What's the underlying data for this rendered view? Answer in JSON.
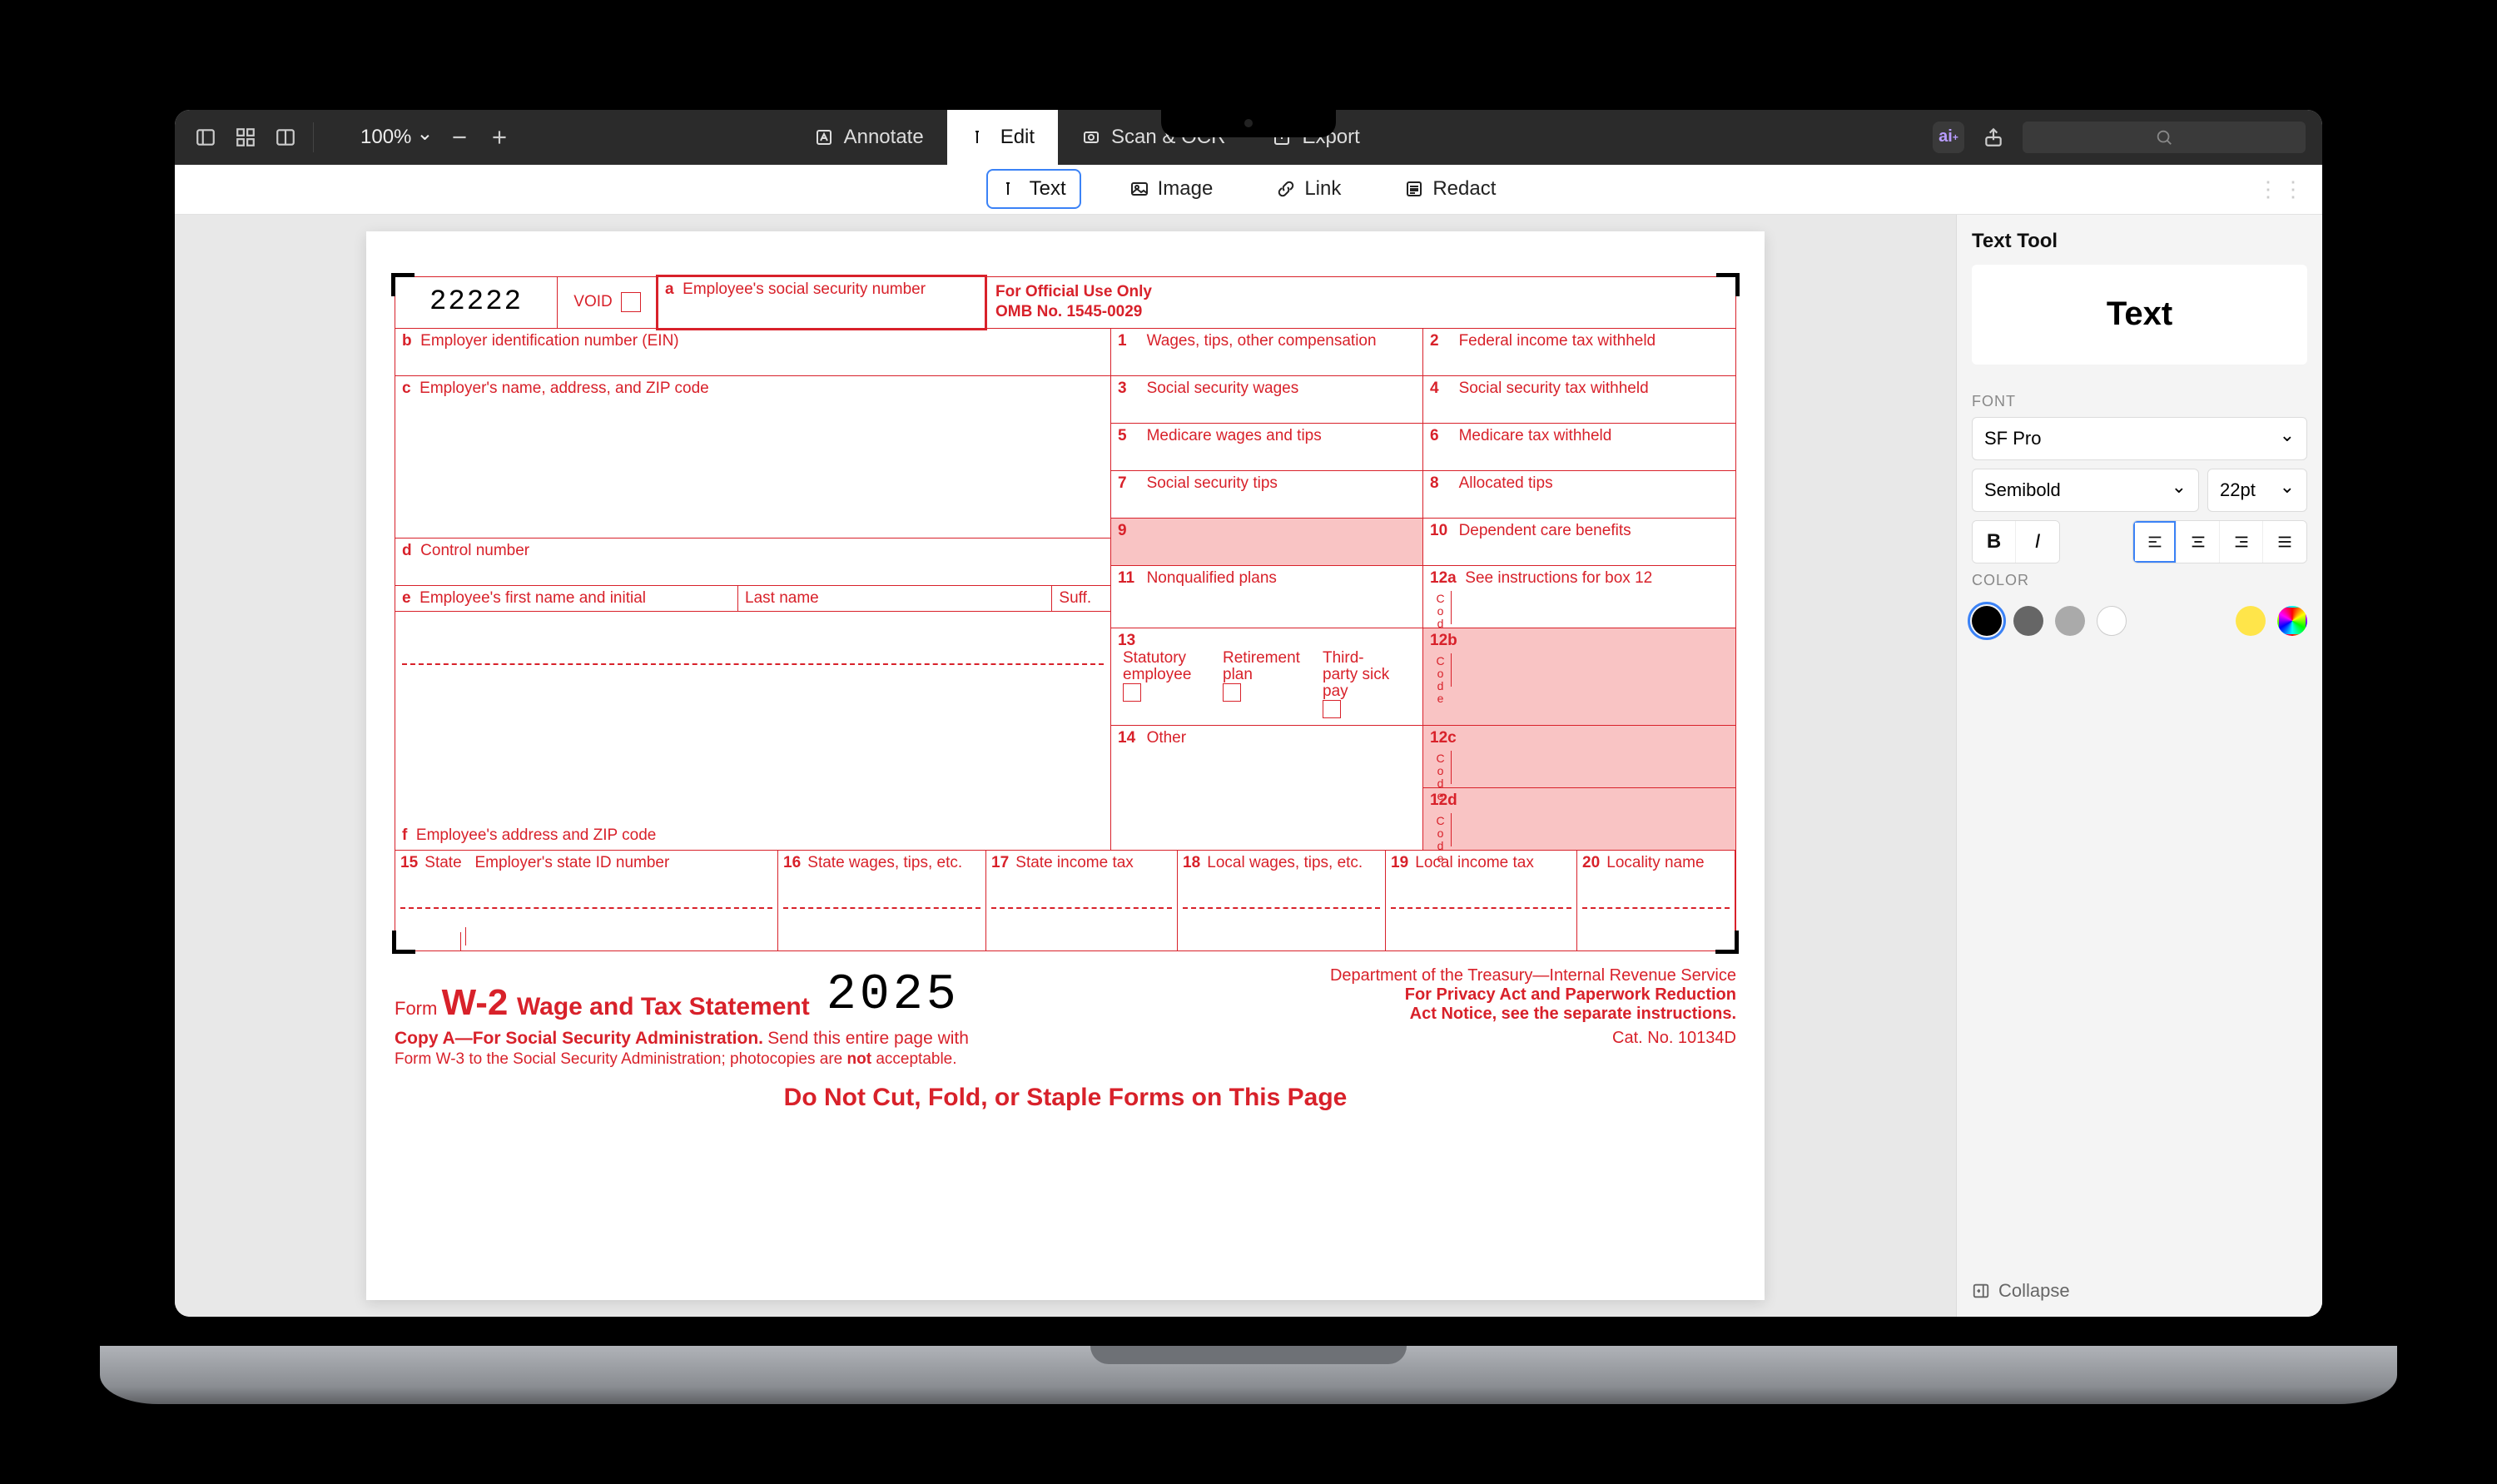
{
  "toolbar": {
    "zoom": "100%",
    "tabs": {
      "annotate": "Annotate",
      "edit": "Edit",
      "scan": "Scan & OCR",
      "export": "Export"
    }
  },
  "subbar": {
    "text": "Text",
    "image": "Image",
    "link": "Link",
    "redact": "Redact"
  },
  "panel": {
    "title": "Text Tool",
    "sample": "Text",
    "font_label": "FONT",
    "font_family": "SF Pro",
    "font_weight": "Semibold",
    "font_size": "22pt",
    "color_label": "COLOR",
    "collapse": "Collapse",
    "swatches": [
      "#000000",
      "#666666",
      "#aaaaaa",
      "#ffffff",
      "#ffe54a"
    ]
  },
  "form": {
    "code22222": "22222",
    "void": "VOID",
    "a": "Employee's social security number",
    "official": "For Official Use Only",
    "omb": "OMB No. 1545-0029",
    "b": "Employer identification number (EIN)",
    "c": "Employer's name, address, and ZIP code",
    "d": "Control number",
    "e": "Employee's first name and initial",
    "lastname": "Last name",
    "suff": "Suff.",
    "f": "Employee's address and ZIP code",
    "box1": "Wages, tips, other compensation",
    "box2": "Federal income tax withheld",
    "box3": "Social security wages",
    "box4": "Social security tax withheld",
    "box5": "Medicare wages and tips",
    "box6": "Medicare tax withheld",
    "box7": "Social security tips",
    "box8": "Allocated tips",
    "box10": "Dependent care benefits",
    "box11": "Nonqualified plans",
    "box12a": "See instructions for box 12",
    "b13a": "Statutory employee",
    "b13b": "Retirement plan",
    "b13c": "Third-party sick pay",
    "box14": "Other",
    "code": "Code",
    "b15": "State",
    "b15b": "Employer's state ID number",
    "b16": "State wages, tips, etc.",
    "b17": "State income tax",
    "b18": "Local wages, tips, etc.",
    "b19": "Local income tax",
    "b20": "Locality name",
    "form": "Form",
    "w2": "W-2",
    "wts": "Wage and Tax Statement",
    "year": "2025",
    "dept": "Department of the Treasury—Internal Revenue Service",
    "privacy1": "For Privacy Act and Paperwork Reduction",
    "privacy2": "Act Notice, see the separate instructions.",
    "copyA": "Copy A—For Social Security Administration.",
    "copyA2": "Send this entire page with",
    "copyA3a": "Form W-3 to the Social Security Administration; photocopies are ",
    "copyA3b": "not",
    "copyA3c": " acceptable.",
    "cat": "Cat. No. 10134D",
    "donot": "Do Not Cut, Fold, or Staple Forms on This Page"
  }
}
